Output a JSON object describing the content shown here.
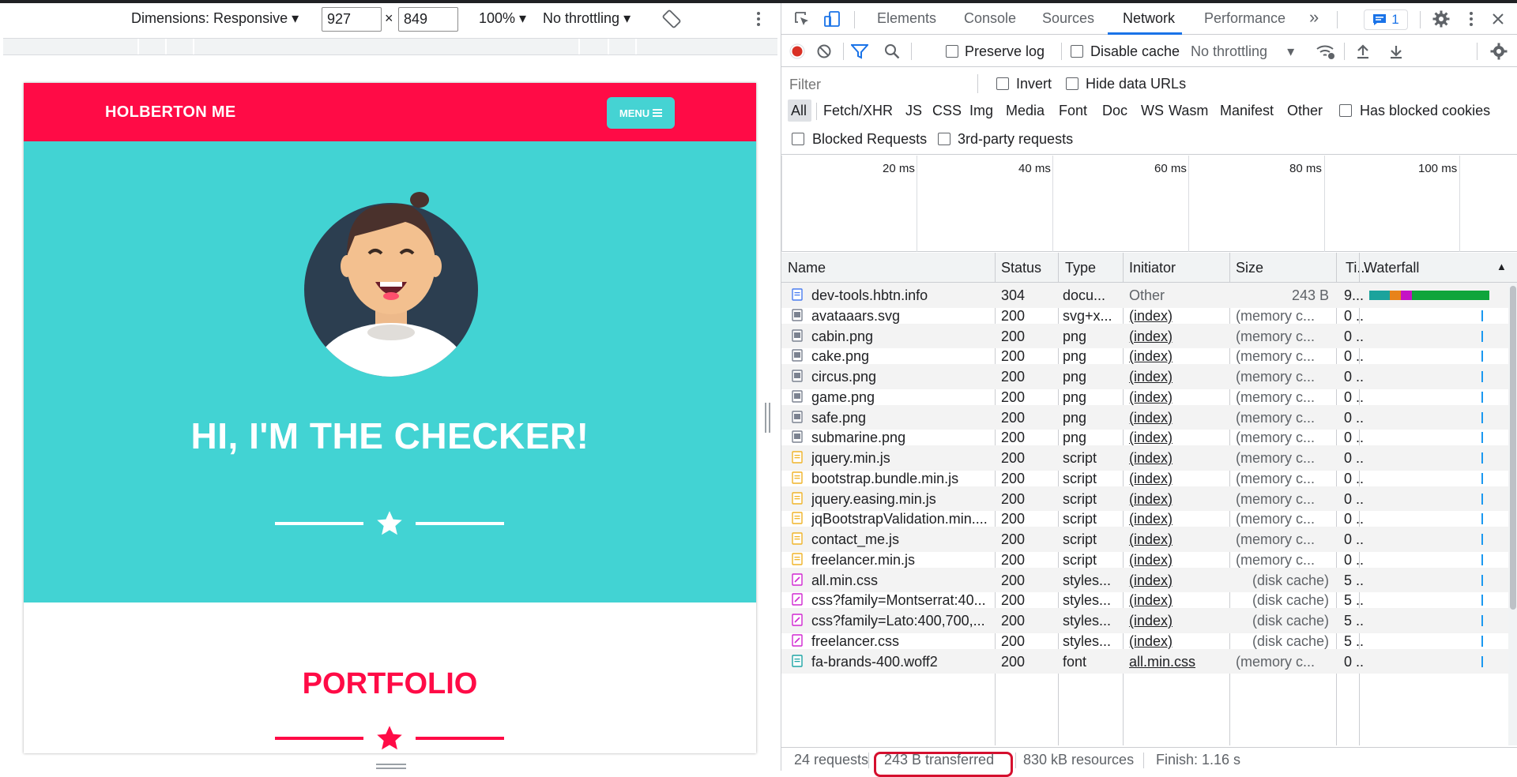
{
  "device_toolbar": {
    "dimensions_label": "Dimensions: Responsive",
    "width_value": "927",
    "height_value": "849",
    "times": "×",
    "zoom": "100%",
    "throttling": "No throttling"
  },
  "site": {
    "brand": "HOLBERTON ME",
    "menu_label": "MENU",
    "hero_title": "HI, I'M THE CHECKER!",
    "portfolio_title": "PORTFOLIO",
    "colors": {
      "nav": "#ff0b46",
      "masthead": "#42d3d3",
      "accent": "#45d3d3"
    }
  },
  "devtools": {
    "tabs": [
      "Elements",
      "Console",
      "Sources",
      "Network",
      "Performance"
    ],
    "active_tab": "Network",
    "more_tabs": "»",
    "issues_count": "1",
    "toolbar": {
      "preserve_log": "Preserve log",
      "disable_cache": "Disable cache",
      "throttling": "No throttling"
    },
    "filter": {
      "placeholder": "Filter",
      "invert": "Invert",
      "hide_data_urls": "Hide data URLs",
      "types": [
        "All",
        "Fetch/XHR",
        "JS",
        "CSS",
        "Img",
        "Media",
        "Font",
        "Doc",
        "WS",
        "Wasm",
        "Manifest",
        "Other"
      ],
      "has_blocked_cookies": "Has blocked cookies",
      "blocked_requests": "Blocked Requests",
      "third_party": "3rd-party requests"
    },
    "overview_ticks": [
      "20 ms",
      "40 ms",
      "60 ms",
      "80 ms",
      "100 ms"
    ],
    "columns": [
      "Name",
      "Status",
      "Type",
      "Initiator",
      "Size",
      "Ti...",
      "Waterfall"
    ],
    "requests": [
      {
        "name": "dev-tools.hbtn.info",
        "status": "304",
        "type": "docu...",
        "initiator": "Other",
        "size": "243 B",
        "time": "9...",
        "icon": "doc"
      },
      {
        "name": "avataaars.svg",
        "status": "200",
        "type": "svg+x...",
        "initiator": "(index)",
        "size": "(memory c...",
        "time": "0 ...",
        "icon": "img"
      },
      {
        "name": "cabin.png",
        "status": "200",
        "type": "png",
        "initiator": "(index)",
        "size": "(memory c...",
        "time": "0 ...",
        "icon": "img"
      },
      {
        "name": "cake.png",
        "status": "200",
        "type": "png",
        "initiator": "(index)",
        "size": "(memory c...",
        "time": "0 ...",
        "icon": "img"
      },
      {
        "name": "circus.png",
        "status": "200",
        "type": "png",
        "initiator": "(index)",
        "size": "(memory c...",
        "time": "0 ...",
        "icon": "img"
      },
      {
        "name": "game.png",
        "status": "200",
        "type": "png",
        "initiator": "(index)",
        "size": "(memory c...",
        "time": "0 ...",
        "icon": "img"
      },
      {
        "name": "safe.png",
        "status": "200",
        "type": "png",
        "initiator": "(index)",
        "size": "(memory c...",
        "time": "0 ...",
        "icon": "img"
      },
      {
        "name": "submarine.png",
        "status": "200",
        "type": "png",
        "initiator": "(index)",
        "size": "(memory c...",
        "time": "0 ...",
        "icon": "img"
      },
      {
        "name": "jquery.min.js",
        "status": "200",
        "type": "script",
        "initiator": "(index)",
        "size": "(memory c...",
        "time": "0 ...",
        "icon": "js"
      },
      {
        "name": "bootstrap.bundle.min.js",
        "status": "200",
        "type": "script",
        "initiator": "(index)",
        "size": "(memory c...",
        "time": "0 ...",
        "icon": "js"
      },
      {
        "name": "jquery.easing.min.js",
        "status": "200",
        "type": "script",
        "initiator": "(index)",
        "size": "(memory c...",
        "time": "0 ...",
        "icon": "js"
      },
      {
        "name": "jqBootstrapValidation.min....",
        "status": "200",
        "type": "script",
        "initiator": "(index)",
        "size": "(memory c...",
        "time": "0 ...",
        "icon": "js"
      },
      {
        "name": "contact_me.js",
        "status": "200",
        "type": "script",
        "initiator": "(index)",
        "size": "(memory c...",
        "time": "0 ...",
        "icon": "js"
      },
      {
        "name": "freelancer.min.js",
        "status": "200",
        "type": "script",
        "initiator": "(index)",
        "size": "(memory c...",
        "time": "0 ...",
        "icon": "js"
      },
      {
        "name": "all.min.css",
        "status": "200",
        "type": "styles...",
        "initiator": "(index)",
        "size": "(disk cache)",
        "time": "5 ...",
        "icon": "css"
      },
      {
        "name": "css?family=Montserrat:40...",
        "status": "200",
        "type": "styles...",
        "initiator": "(index)",
        "size": "(disk cache)",
        "time": "5 ...",
        "icon": "css"
      },
      {
        "name": "css?family=Lato:400,700,...",
        "status": "200",
        "type": "styles...",
        "initiator": "(index)",
        "size": "(disk cache)",
        "time": "5 ...",
        "icon": "css"
      },
      {
        "name": "freelancer.css",
        "status": "200",
        "type": "styles...",
        "initiator": "(index)",
        "size": "(disk cache)",
        "time": "5 ...",
        "icon": "css"
      },
      {
        "name": "fa-brands-400.woff2",
        "status": "200",
        "type": "font",
        "initiator": "all.min.css",
        "size": "(memory c...",
        "time": "0 ...",
        "icon": "font"
      }
    ],
    "status": {
      "requests": "24 requests",
      "transferred": "243 B transferred",
      "resources": "830 kB resources",
      "finish": "Finish: 1.16 s"
    }
  }
}
